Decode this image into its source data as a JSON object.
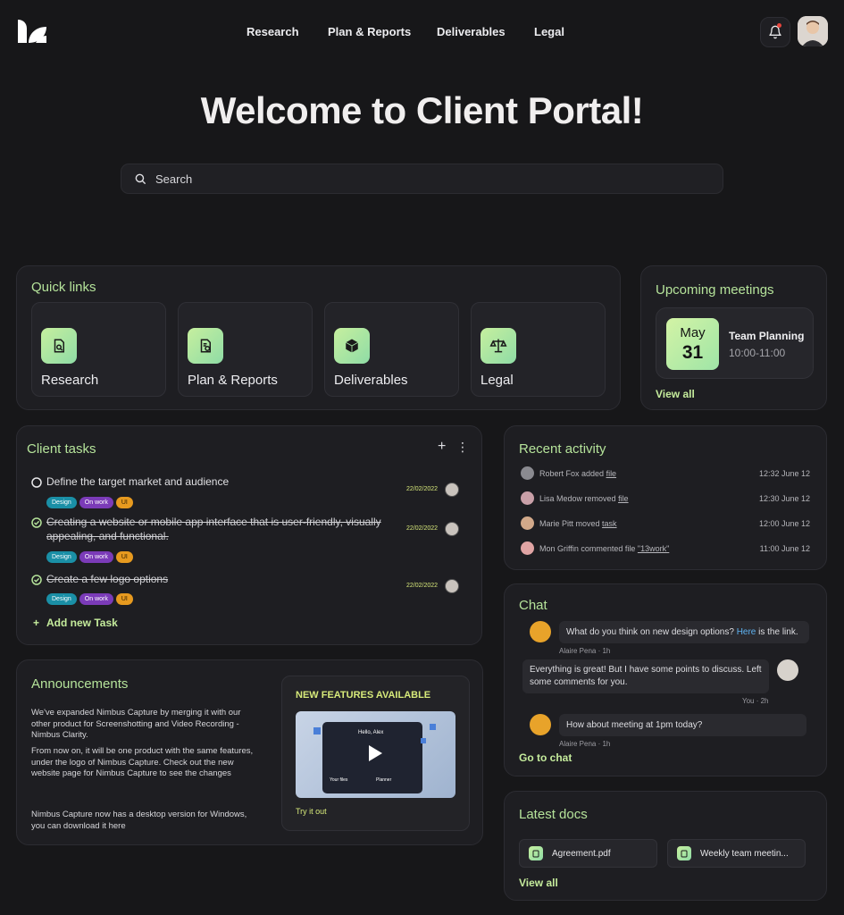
{
  "nav": {
    "items": [
      "Research",
      "Plan & Reports",
      "Deliverables",
      "Legal"
    ]
  },
  "header": {
    "title": "Welcome to Client Portal!"
  },
  "search": {
    "placeholder": "Search"
  },
  "quick_links": {
    "title": "Quick links",
    "items": [
      "Research",
      "Plan & Reports",
      "Deliverables",
      "Legal"
    ]
  },
  "meetings": {
    "title": "Upcoming meetings",
    "month": "May",
    "day": "31",
    "name": "Team Planning",
    "time": "10:00-11:00",
    "view_all": "View all"
  },
  "tasks": {
    "title": "Client tasks",
    "add_icon": "+",
    "more_icon": "⋮",
    "items": [
      {
        "text": "Define the target market and audience",
        "done": false,
        "date": "22/02/2022",
        "tags": [
          "Design",
          "On work",
          "UI"
        ]
      },
      {
        "text": "Creating a website or mobile app interface that is user-friendly, visually appealing, and functional.",
        "done": true,
        "date": "22/02/2022",
        "tags": [
          "Design",
          "On work",
          "UI"
        ]
      },
      {
        "text": "Create a few logo options",
        "done": true,
        "date": "22/02/2022",
        "tags": [
          "Design",
          "On work",
          "UI"
        ]
      }
    ],
    "add_label": "Add new Task"
  },
  "activity": {
    "title": "Recent activity",
    "rows": [
      {
        "who": "Robert Fox added",
        "obj": "file",
        "time": "12:32 June 12"
      },
      {
        "who": "Lisa Medow removed",
        "obj": "file",
        "time": "12:30 June 12"
      },
      {
        "who": "Marie Pitt moved",
        "obj": "task",
        "time": "12:00 June 12"
      },
      {
        "who": "Mon Griffin commented file",
        "obj": "\"13work\"",
        "time": "11:00 June 12"
      }
    ]
  },
  "chat": {
    "title": "Chat",
    "m1_a": "What do you think on new design options? ",
    "m1_link": "Here",
    "m1_b": " is the link.",
    "m1_meta": "Alaire Pena · 1h",
    "m2": "Everything is great! But I have some points to discuss. Left some comments for you.",
    "m2_meta": "You · 2h",
    "m3": "How about meeting at 1pm today?",
    "m3_meta": "Alaire Pena · 1h",
    "go": "Go to chat"
  },
  "announcements": {
    "title": "Announcements",
    "p1": "We've expanded Nimbus Capture by merging it with our other product for Screenshotting and Video Recording - Nimbus Clarity.",
    "p2": "From now on, it will be one product with the same features, under the logo of Nimbus Capture. Check out the new website page for Nimbus Capture to see the changes",
    "p3": "Nimbus Capture now has a desktop version for Windows, you can download it here",
    "feature_title": "NEW FEATURES AVAILABLE",
    "video_greeting": "Hello, Alex",
    "video_files": "Your files",
    "video_planner": "Planner",
    "try": "Try it out"
  },
  "docs": {
    "title": "Latest docs",
    "items": [
      "Agreement.pdf",
      "Weekly team meetin..."
    ],
    "view_all": "View all"
  },
  "colors": {
    "accent": "#b5e39a",
    "bg": "#171719",
    "card": "#1e1e22",
    "notification": "#e8453c"
  }
}
